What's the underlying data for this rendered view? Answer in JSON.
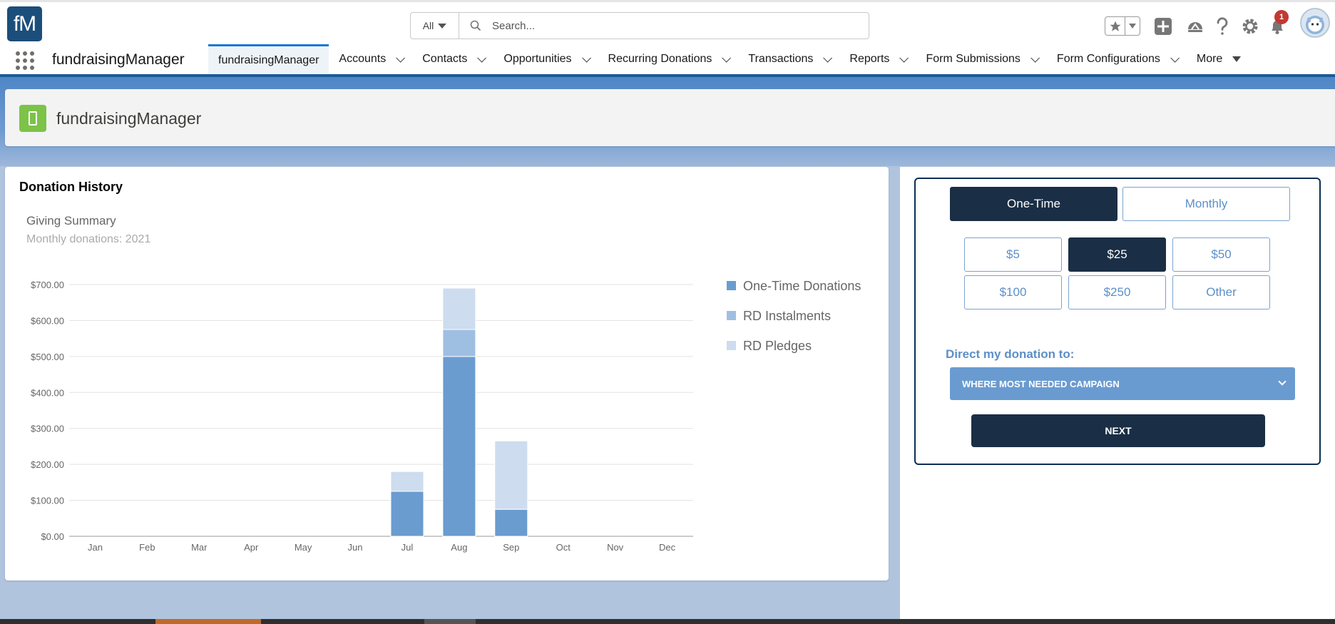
{
  "header": {
    "logo_text": "fM",
    "search_scope": "All",
    "search_placeholder": "Search...",
    "notification_count": "1"
  },
  "nav": {
    "app_name": "fundraisingManager",
    "tabs": [
      {
        "label": "fundraisingManager",
        "active": true
      },
      {
        "label": "Accounts"
      },
      {
        "label": "Contacts"
      },
      {
        "label": "Opportunities"
      },
      {
        "label": "Recurring Donations"
      },
      {
        "label": "Transactions"
      },
      {
        "label": "Reports"
      },
      {
        "label": "Form Submissions"
      },
      {
        "label": "Form Configurations"
      },
      {
        "label": "More"
      }
    ]
  },
  "page_header": {
    "title": "fundraisingManager"
  },
  "donation_history": {
    "title": "Donation History",
    "subtitle": "Giving Summary",
    "caption": "Monthly donations: 2021"
  },
  "chart_data": {
    "type": "bar",
    "stacked": true,
    "categories": [
      "Jan",
      "Feb",
      "Mar",
      "Apr",
      "May",
      "Jun",
      "Jul",
      "Aug",
      "Sep",
      "Oct",
      "Nov",
      "Dec"
    ],
    "series": [
      {
        "name": "One-Time Donations",
        "color": "#6a9ccf",
        "values": [
          0,
          0,
          0,
          0,
          0,
          0,
          125,
          500,
          75,
          0,
          0,
          0
        ]
      },
      {
        "name": "RD Instalments",
        "color": "#9fbfe2",
        "values": [
          0,
          0,
          0,
          0,
          0,
          0,
          0,
          75,
          0,
          0,
          0,
          0
        ]
      },
      {
        "name": "RD Pledges",
        "color": "#cddcee",
        "values": [
          0,
          0,
          0,
          0,
          0,
          0,
          55,
          115,
          190,
          0,
          0,
          0
        ]
      }
    ],
    "yticks": [
      "$0.00",
      "$100.00",
      "$200.00",
      "$300.00",
      "$400.00",
      "$500.00",
      "$600.00",
      "$700.00"
    ],
    "ylim": [
      0,
      700
    ],
    "grid": true,
    "legend_position": "right"
  },
  "donate": {
    "frequency": [
      "One-Time",
      "Monthly"
    ],
    "selected_frequency": "One-Time",
    "amounts": [
      "$5",
      "$25",
      "$50",
      "$100",
      "$250",
      "Other"
    ],
    "selected_amount": "$25",
    "direct_label": "Direct my donation to:",
    "campaign": "WHERE MOST NEEDED CAMPAIGN",
    "next_label": "NEXT"
  },
  "colors": {
    "brand_dark": "#1a2f45",
    "accent_blue": "#5d8fc7",
    "nav_border": "#1b5a98"
  }
}
